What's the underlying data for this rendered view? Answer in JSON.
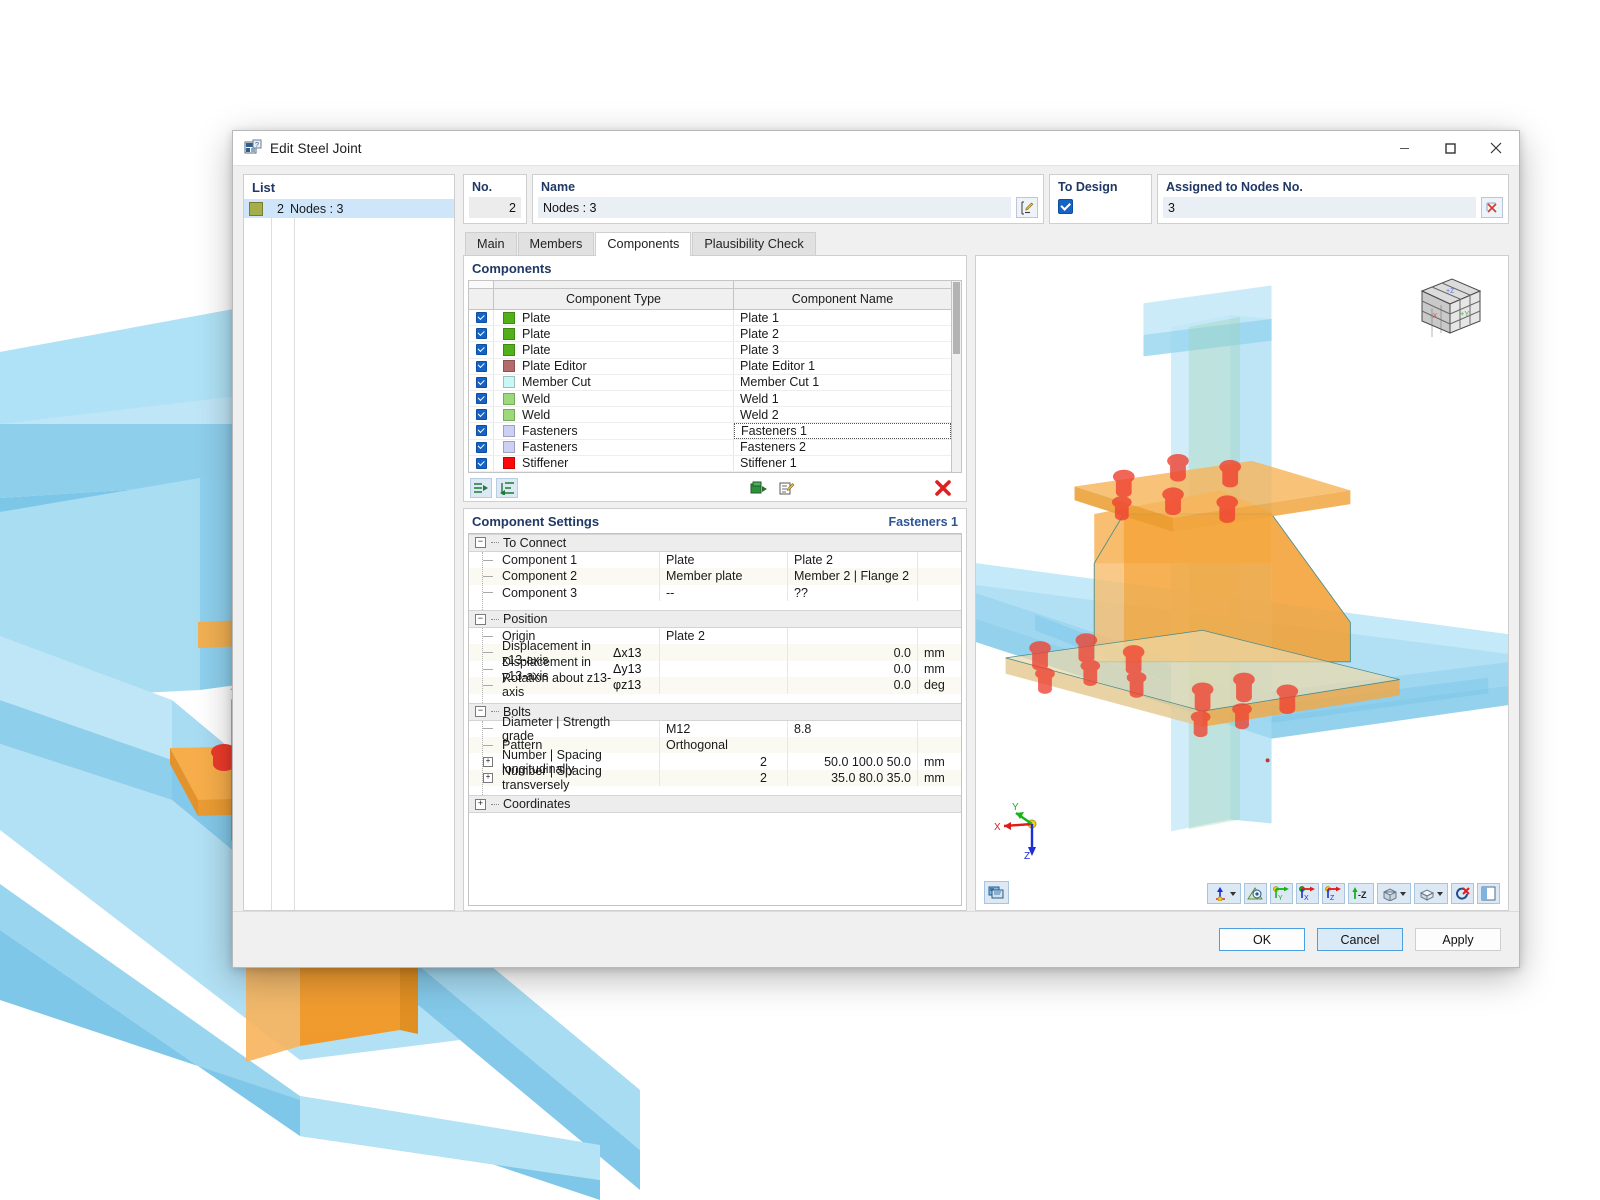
{
  "window": {
    "title": "Edit Steel Joint",
    "icon": "steel-joint-icon",
    "minimize": "—",
    "maximize": "☐",
    "close": "✕"
  },
  "list_panel": {
    "header": "List",
    "rows": [
      {
        "swatch_color": "#a5ae4b",
        "no": "2",
        "label": "Nodes : 3",
        "selected": true
      }
    ]
  },
  "fields": {
    "no": {
      "label": "No.",
      "value": "2"
    },
    "name": {
      "label": "Name",
      "value": "Nodes : 3",
      "edit_icon": "edit-pencil-icon"
    },
    "to_design": {
      "label": "To Design",
      "checked": true
    },
    "assigned_nodes": {
      "label": "Assigned to Nodes No.",
      "value": "3",
      "pick_icon": "pick-node-icon"
    }
  },
  "tabs": [
    {
      "label": "Main",
      "active": false
    },
    {
      "label": "Members",
      "active": false
    },
    {
      "label": "Components",
      "active": true
    },
    {
      "label": "Plausibility Check",
      "active": false
    }
  ],
  "components_panel": {
    "header": "Components",
    "columns": [
      "Component Type",
      "Component Name"
    ],
    "rows": [
      {
        "checked": true,
        "swatch": "#52b018",
        "type": "Plate",
        "name": "Plate 1",
        "editing": false
      },
      {
        "checked": true,
        "swatch": "#52b018",
        "type": "Plate",
        "name": "Plate 2",
        "editing": false
      },
      {
        "checked": true,
        "swatch": "#52b018",
        "type": "Plate",
        "name": "Plate 3",
        "editing": false
      },
      {
        "checked": true,
        "swatch": "#b56b6b",
        "type": "Plate Editor",
        "name": "Plate Editor 1",
        "editing": false
      },
      {
        "checked": true,
        "swatch": "#c9f7f5",
        "type": "Member Cut",
        "name": "Member Cut 1",
        "editing": false
      },
      {
        "checked": true,
        "swatch": "#9cd97a",
        "type": "Weld",
        "name": "Weld 1",
        "editing": false
      },
      {
        "checked": true,
        "swatch": "#9cd97a",
        "type": "Weld",
        "name": "Weld 2",
        "editing": false
      },
      {
        "checked": true,
        "swatch": "#ccd0f2",
        "type": "Fasteners",
        "name": "Fasteners 1",
        "editing": true
      },
      {
        "checked": true,
        "swatch": "#ccd0f2",
        "type": "Fasteners",
        "name": "Fasteners 2",
        "editing": false
      },
      {
        "checked": true,
        "swatch": "#fa0a0a",
        "type": "Stiffener",
        "name": "Stiffener 1",
        "editing": false
      }
    ],
    "toolbar": {
      "insert_before_icon": "insert-row-before-icon",
      "insert_after_icon": "insert-row-after-icon",
      "run_icon": "run-component-icon",
      "edit_icon": "edit-component-icon",
      "delete_icon": "delete-red-x-icon"
    }
  },
  "settings_panel": {
    "header": "Component Settings",
    "context": "Fasteners 1",
    "groups": [
      {
        "name": "To Connect",
        "expander": "−",
        "rows": [
          {
            "name": "Component 1",
            "sym": "",
            "v1": "Plate",
            "v2": "Plate 2",
            "num": "",
            "unit": ""
          },
          {
            "name": "Component 2",
            "sym": "",
            "v1": "Member plate",
            "v2": "Member 2 | Flange 2",
            "num": "",
            "unit": ""
          },
          {
            "name": "Component 3",
            "sym": "",
            "v1": "--",
            "v2": "??",
            "num": "",
            "unit": ""
          }
        ]
      },
      {
        "name": "Position",
        "expander": "−",
        "rows": [
          {
            "name": "Origin",
            "sym": "",
            "v1": "Plate 2",
            "v2": "",
            "num": "",
            "unit": ""
          },
          {
            "name": "Displacement in x13-axis",
            "sym": "Δx13",
            "v1": "",
            "v2": "",
            "num": "0.0",
            "unit": "mm"
          },
          {
            "name": "Displacement in y13-axis",
            "sym": "Δy13",
            "v1": "",
            "v2": "",
            "num": "0.0",
            "unit": "mm"
          },
          {
            "name": "Rotation about z13-axis",
            "sym": "φz13",
            "v1": "",
            "v2": "",
            "num": "0.0",
            "unit": "deg"
          }
        ]
      },
      {
        "name": "Bolts",
        "expander": "−",
        "rows": [
          {
            "name": "Diameter | Strength grade",
            "sym": "",
            "v1": "M12",
            "v2": "8.8",
            "num": "",
            "unit": "",
            "plus": false
          },
          {
            "name": "Pattern",
            "sym": "",
            "v1": "Orthogonal",
            "v2": "",
            "num": "",
            "unit": "",
            "plus": false
          },
          {
            "name": "Number | Spacing longitudinally",
            "sym": "",
            "v1": "",
            "v2": "",
            "count": "2",
            "num": "50.0 100.0 50.0",
            "unit": "mm",
            "plus": true
          },
          {
            "name": "Number | Spacing transversely",
            "sym": "",
            "v1": "",
            "v2": "",
            "count": "2",
            "num": "35.0 80.0 35.0",
            "unit": "mm",
            "plus": true
          }
        ]
      },
      {
        "name": "Coordinates",
        "expander": "+",
        "rows": []
      }
    ]
  },
  "viewport": {
    "nav_cube": {
      "icon": "view-cube-icon",
      "faces": {
        "x": "-X",
        "y": "+Y",
        "z": "+Z"
      }
    },
    "axis_gizmo": {
      "icon": "axis-gizmo-icon",
      "x": "X",
      "y": "Y",
      "z": "Z"
    },
    "bottom_left": [
      {
        "icon": "render-settings-icon",
        "name": "render-settings-button"
      }
    ],
    "bottom_right": [
      {
        "icon": "zoom-axis-icon",
        "name": "view-origin-button",
        "caret": true
      },
      {
        "icon": "perspective-icon",
        "name": "perspective-button",
        "caret": false
      },
      {
        "icon": "view-in-y-icon",
        "name": "view-in-y-button",
        "caret": false
      },
      {
        "icon": "view-in-x-icon",
        "name": "view-in-x-button",
        "caret": false
      },
      {
        "icon": "view-in-z-icon",
        "name": "view-in-z-button",
        "caret": false
      },
      {
        "icon": "view-minus-z-icon",
        "name": "view-minus-z-button",
        "caret": false,
        "label": "-Z"
      },
      {
        "icon": "render-mode-icon",
        "name": "render-mode-button",
        "caret": true
      },
      {
        "icon": "solid-model-icon",
        "name": "solid-model-button",
        "caret": true
      },
      {
        "icon": "clear-selection-icon",
        "name": "clear-selection-button",
        "caret": false
      },
      {
        "icon": "panel-toggle-icon",
        "name": "panel-toggle-button",
        "caret": false
      }
    ]
  },
  "footer": {
    "ok": "OK",
    "cancel": "Cancel",
    "apply": "Apply"
  },
  "colors": {
    "accent_blue": "#1f3864",
    "checkbox_blue": "#1464c8",
    "selection_blue": "#cfe6fa",
    "steel_blue": "#8fd2ef",
    "plate_orange": "#f5a33c",
    "bolt_red": "#ef4130",
    "delete_red": "#e02020"
  }
}
